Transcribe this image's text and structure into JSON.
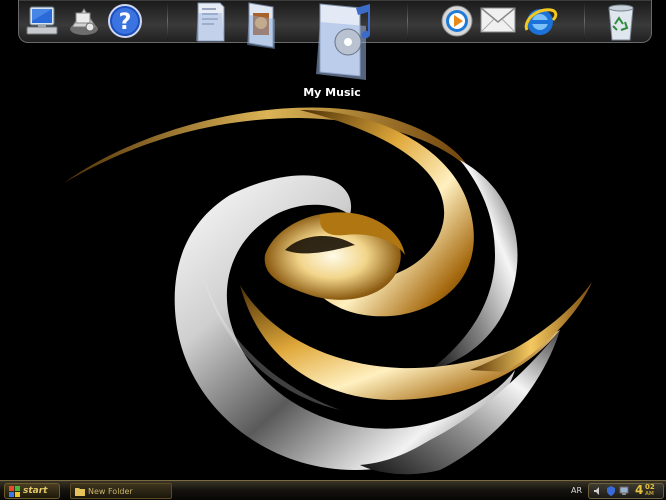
{
  "desktop": {
    "dock": {
      "items": [
        {
          "name": "my-computer",
          "label": "My Computer"
        },
        {
          "name": "network-places",
          "label": "My Network Places"
        },
        {
          "name": "help-support",
          "label": "Help and Support"
        },
        {
          "name": "my-documents",
          "label": "My Documents"
        },
        {
          "name": "my-pictures",
          "label": "My Pictures"
        },
        {
          "name": "my-music",
          "label": "My Music"
        },
        {
          "name": "media-player",
          "label": "Windows Media Player"
        },
        {
          "name": "mail",
          "label": "E-mail"
        },
        {
          "name": "internet-explorer",
          "label": "Internet Explorer"
        },
        {
          "name": "recycle-bin",
          "label": "Recycle Bin"
        }
      ],
      "hover_label": "My Music"
    },
    "wallpaper": {
      "description_colors": {
        "gold": "#c8921e",
        "silver": "#d8d8d8",
        "background": "#000000"
      }
    }
  },
  "taskbar": {
    "start_label": "start",
    "task_button_label": "New Folder",
    "language": "AR",
    "clock": {
      "hour": "4",
      "minute": "02",
      "period": "AM"
    }
  }
}
